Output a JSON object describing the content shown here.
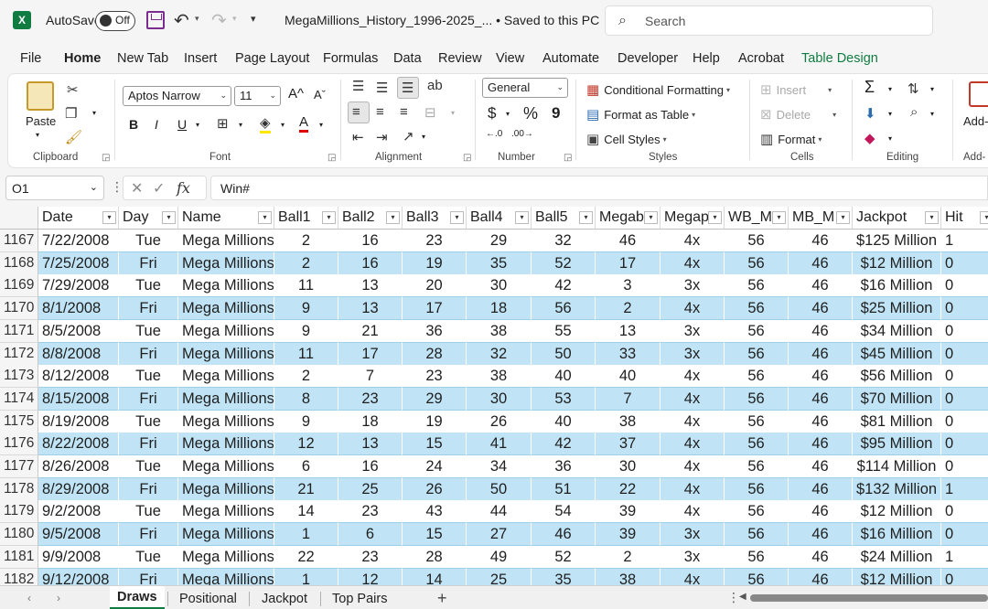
{
  "titlebar": {
    "logo": "X",
    "autosave_label": "AutoSave",
    "autosave_state": "Off",
    "document_title": "MegaMillions_History_1996-2025_... • Saved to this PC ⌄",
    "search_placeholder": "Search"
  },
  "tabs": [
    "File",
    "Home",
    "New Tab",
    "Insert",
    "Page Layout",
    "Formulas",
    "Data",
    "Review",
    "View",
    "Automate",
    "Developer",
    "Help",
    "Acrobat",
    "Table Design"
  ],
  "active_tab": "Home",
  "ribbon": {
    "clipboard": {
      "label": "Clipboard",
      "paste": "Paste"
    },
    "font": {
      "label": "Font",
      "font_name": "Aptos Narrow",
      "font_size": "11",
      "bold": "B",
      "italic": "I",
      "underline": "U"
    },
    "alignment": {
      "label": "Alignment"
    },
    "number": {
      "label": "Number",
      "format": "General",
      "currency": "$",
      "percent": "%",
      "comma": "9"
    },
    "styles": {
      "label": "Styles",
      "conditional": "Conditional Formatting",
      "format_table": "Format as Table",
      "cell_styles": "Cell Styles"
    },
    "cells": {
      "label": "Cells",
      "insert": "Insert",
      "delete": "Delete",
      "format": "Format"
    },
    "editing": {
      "label": "Editing",
      "sum": "Σ"
    },
    "addins": {
      "label": "Add-",
      "label2": "Add-"
    }
  },
  "formula_bar": {
    "name_box": "O1",
    "formula": "Win#"
  },
  "columns": [
    {
      "name": "Date",
      "align": "l"
    },
    {
      "name": "Day",
      "align": "c"
    },
    {
      "name": "Name",
      "align": "l"
    },
    {
      "name": "Ball1",
      "align": "c"
    },
    {
      "name": "Ball2",
      "align": "c"
    },
    {
      "name": "Ball3",
      "align": "c"
    },
    {
      "name": "Ball4",
      "align": "c"
    },
    {
      "name": "Ball5",
      "align": "c"
    },
    {
      "name": "Megab",
      "align": "c"
    },
    {
      "name": "Megap",
      "align": "c"
    },
    {
      "name": "WB_M",
      "align": "c"
    },
    {
      "name": "MB_M",
      "align": "c"
    },
    {
      "name": "Jackpot",
      "align": "c"
    },
    {
      "name": "Hit",
      "align": "l"
    }
  ],
  "rows": [
    {
      "num": "1167",
      "cells": [
        "7/22/2008",
        "Tue",
        "Mega Millions",
        "2",
        "16",
        "23",
        "29",
        "32",
        "46",
        "4x",
        "56",
        "46",
        "$125 Million",
        "1"
      ]
    },
    {
      "num": "1168",
      "cells": [
        "7/25/2008",
        "Fri",
        "Mega Millions",
        "2",
        "16",
        "19",
        "35",
        "52",
        "17",
        "4x",
        "56",
        "46",
        "$12 Million",
        "0"
      ]
    },
    {
      "num": "1169",
      "cells": [
        "7/29/2008",
        "Tue",
        "Mega Millions",
        "11",
        "13",
        "20",
        "30",
        "42",
        "3",
        "3x",
        "56",
        "46",
        "$16 Million",
        "0"
      ]
    },
    {
      "num": "1170",
      "cells": [
        "8/1/2008",
        "Fri",
        "Mega Millions",
        "9",
        "13",
        "17",
        "18",
        "56",
        "2",
        "4x",
        "56",
        "46",
        "$25 Million",
        "0"
      ]
    },
    {
      "num": "1171",
      "cells": [
        "8/5/2008",
        "Tue",
        "Mega Millions",
        "9",
        "21",
        "36",
        "38",
        "55",
        "13",
        "3x",
        "56",
        "46",
        "$34 Million",
        "0"
      ]
    },
    {
      "num": "1172",
      "cells": [
        "8/8/2008",
        "Fri",
        "Mega Millions",
        "11",
        "17",
        "28",
        "32",
        "50",
        "33",
        "3x",
        "56",
        "46",
        "$45 Million",
        "0"
      ]
    },
    {
      "num": "1173",
      "cells": [
        "8/12/2008",
        "Tue",
        "Mega Millions",
        "2",
        "7",
        "23",
        "38",
        "40",
        "40",
        "4x",
        "56",
        "46",
        "$56 Million",
        "0"
      ]
    },
    {
      "num": "1174",
      "cells": [
        "8/15/2008",
        "Fri",
        "Mega Millions",
        "8",
        "23",
        "29",
        "30",
        "53",
        "7",
        "4x",
        "56",
        "46",
        "$70 Million",
        "0"
      ]
    },
    {
      "num": "1175",
      "cells": [
        "8/19/2008",
        "Tue",
        "Mega Millions",
        "9",
        "18",
        "19",
        "26",
        "40",
        "38",
        "4x",
        "56",
        "46",
        "$81 Million",
        "0"
      ]
    },
    {
      "num": "1176",
      "cells": [
        "8/22/2008",
        "Fri",
        "Mega Millions",
        "12",
        "13",
        "15",
        "41",
        "42",
        "37",
        "4x",
        "56",
        "46",
        "$95 Million",
        "0"
      ]
    },
    {
      "num": "1177",
      "cells": [
        "8/26/2008",
        "Tue",
        "Mega Millions",
        "6",
        "16",
        "24",
        "34",
        "36",
        "30",
        "4x",
        "56",
        "46",
        "$114 Million",
        "0"
      ]
    },
    {
      "num": "1178",
      "cells": [
        "8/29/2008",
        "Fri",
        "Mega Millions",
        "21",
        "25",
        "26",
        "50",
        "51",
        "22",
        "4x",
        "56",
        "46",
        "$132 Million",
        "1"
      ]
    },
    {
      "num": "1179",
      "cells": [
        "9/2/2008",
        "Tue",
        "Mega Millions",
        "14",
        "23",
        "43",
        "44",
        "54",
        "39",
        "4x",
        "56",
        "46",
        "$12 Million",
        "0"
      ]
    },
    {
      "num": "1180",
      "cells": [
        "9/5/2008",
        "Fri",
        "Mega Millions",
        "1",
        "6",
        "15",
        "27",
        "46",
        "39",
        "3x",
        "56",
        "46",
        "$16 Million",
        "0"
      ]
    },
    {
      "num": "1181",
      "cells": [
        "9/9/2008",
        "Tue",
        "Mega Millions",
        "22",
        "23",
        "28",
        "49",
        "52",
        "2",
        "3x",
        "56",
        "46",
        "$24 Million",
        "1"
      ]
    },
    {
      "num": "1182",
      "cells": [
        "9/12/2008",
        "Fri",
        "Mega Millions",
        "1",
        "12",
        "14",
        "25",
        "35",
        "38",
        "4x",
        "56",
        "46",
        "$12 Million",
        "0"
      ]
    }
  ],
  "sheets": [
    "Draws",
    "Positional",
    "Jackpot",
    "Top Pairs"
  ],
  "active_sheet": "Draws",
  "colors": {
    "accent": "#107c41",
    "band": "#c0e4f5"
  }
}
